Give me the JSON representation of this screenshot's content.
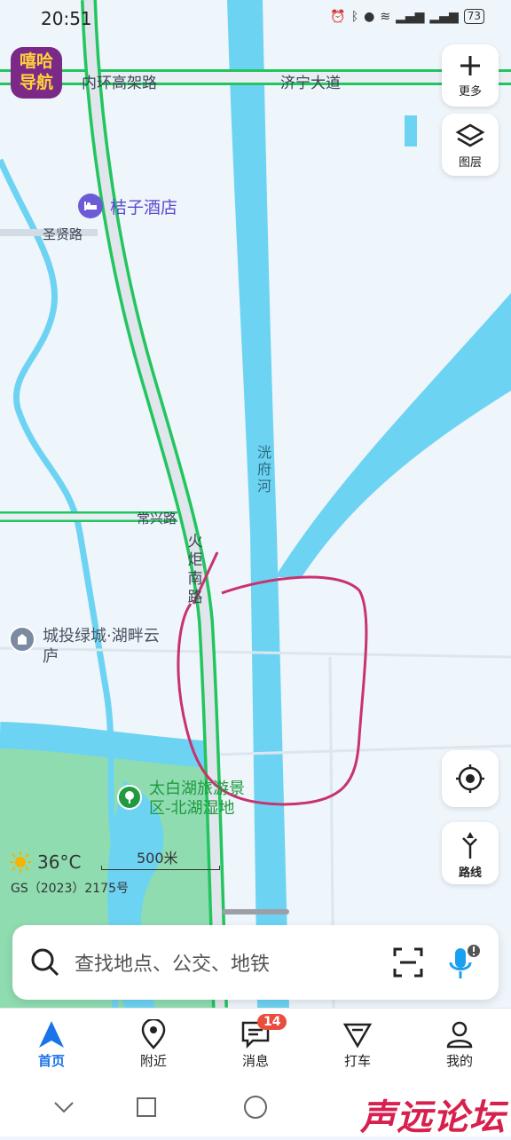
{
  "status_bar": {
    "time": "20:51",
    "battery": "73"
  },
  "app": {
    "logo_line1": "嘻哈",
    "logo_line2": "导航"
  },
  "map": {
    "roads": {
      "inner_ring": "内环高架路",
      "jining": "济宁大道",
      "shengxian": "圣贤路",
      "changxing": "常兴路",
      "huoju": "火炬南路"
    },
    "rivers": {
      "guangfu": "洸府河"
    },
    "pois": {
      "hotel": "桔子酒店",
      "residence": "城投绿城·湖畔云庐",
      "park": "太白湖旅游景区-北湖湿地"
    }
  },
  "side_buttons": {
    "more": "更多",
    "layers": "图层",
    "route": "路线"
  },
  "weather": {
    "temperature": "36°C",
    "icon": "sun-icon"
  },
  "scale": {
    "label": "500米"
  },
  "license": "GS（2023）2175号",
  "search": {
    "placeholder": "查找地点、公交、地铁"
  },
  "tabs": [
    {
      "label": "首页",
      "icon": "navigation-arrow-icon",
      "active": true
    },
    {
      "label": "附近",
      "icon": "location-pin-icon"
    },
    {
      "label": "消息",
      "icon": "message-icon",
      "badge": "14"
    },
    {
      "label": "打车",
      "icon": "taxi-icon"
    },
    {
      "label": "我的",
      "icon": "user-icon"
    }
  ],
  "watermark": "声远论坛",
  "colors": {
    "road_border": "#22c55e",
    "water": "#6dd3f3",
    "park": "#8fdcb1",
    "annotation": "#c8326e",
    "accent": "#1a73e8"
  }
}
